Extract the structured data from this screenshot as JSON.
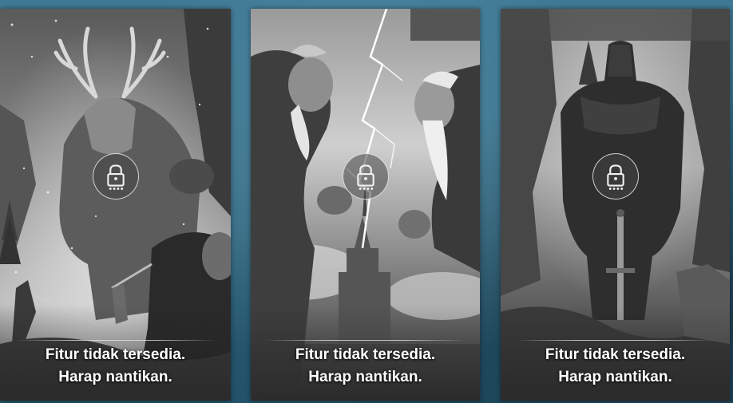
{
  "cards": [
    {
      "art": "frost-giant-battle-art",
      "icon": "lock-icon",
      "locked": true,
      "line1": "Fitur tidak tersedia.",
      "line2": "Harap nantikan."
    },
    {
      "art": "lightning-duel-art",
      "icon": "lock-icon",
      "locked": true,
      "line1": "Fitur tidak tersedia.",
      "line2": "Harap nantikan."
    },
    {
      "art": "dark-knight-sword-art",
      "icon": "lock-icon",
      "locked": true,
      "line1": "Fitur tidak tersedia.",
      "line2": "Harap nantikan."
    }
  ],
  "colors": {
    "background": "#2f6882",
    "card_tint": "#6d6d6d",
    "caption_text": "#ffffff"
  }
}
